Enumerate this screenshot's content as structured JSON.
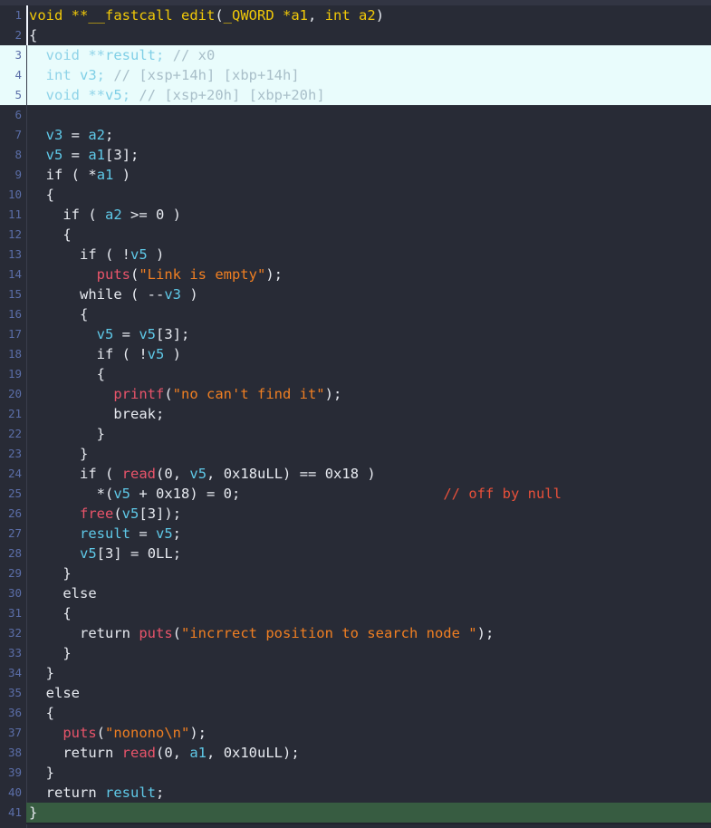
{
  "view": {
    "title": "IDA Pro pseudocode decompiler view",
    "function_name": "edit",
    "theme": {
      "background": "#282b36",
      "gutter_text": "#5b6ea8",
      "plain_text": "#e7eaf0",
      "variable": "#5fc9e8",
      "function_call": "#e8546a",
      "string": "#f07f22",
      "comment": "#e8503a",
      "prototype": "#f0c808",
      "selection_background": "#e9fcfc",
      "current_line_background": "#375c41"
    },
    "total_lines": 41
  },
  "lines": [
    {
      "n": "1",
      "state": "normal",
      "indent": 0,
      "tokens": [
        {
          "t": "void ",
          "c": "proto"
        },
        {
          "t": "**",
          "c": "proto"
        },
        {
          "t": "__fastcall ",
          "c": "proto"
        },
        {
          "t": "edit",
          "c": "proto"
        },
        {
          "t": "(",
          "c": "op"
        },
        {
          "t": "_QWORD ",
          "c": "proto"
        },
        {
          "t": "*",
          "c": "proto"
        },
        {
          "t": "a1",
          "c": "proto"
        },
        {
          "t": ", ",
          "c": "op"
        },
        {
          "t": "int ",
          "c": "proto"
        },
        {
          "t": "a2",
          "c": "proto"
        },
        {
          "t": ")",
          "c": "op"
        }
      ]
    },
    {
      "n": "2",
      "state": "normal",
      "indent": 0,
      "tokens": [
        {
          "t": "{",
          "c": "brc"
        }
      ]
    },
    {
      "n": "3",
      "state": "selected",
      "indent": 1,
      "tokens": [
        {
          "t": "void ",
          "c": "kw"
        },
        {
          "t": "**",
          "c": "op"
        },
        {
          "t": "result",
          "c": "var"
        },
        {
          "t": "; ",
          "c": "op"
        },
        {
          "t": "// x0",
          "c": "cm"
        }
      ]
    },
    {
      "n": "4",
      "state": "selected",
      "indent": 1,
      "tokens": [
        {
          "t": "int ",
          "c": "kw"
        },
        {
          "t": "v3",
          "c": "var"
        },
        {
          "t": "; ",
          "c": "op"
        },
        {
          "t": "// [xsp+14h] [xbp+14h]",
          "c": "cm"
        }
      ]
    },
    {
      "n": "5",
      "state": "selected",
      "indent": 1,
      "tokens": [
        {
          "t": "void ",
          "c": "kw"
        },
        {
          "t": "**",
          "c": "op"
        },
        {
          "t": "v5",
          "c": "var"
        },
        {
          "t": "; ",
          "c": "op"
        },
        {
          "t": "// [xsp+20h] [xbp+20h]",
          "c": "cm"
        }
      ]
    },
    {
      "n": "6",
      "state": "normal",
      "indent": 0,
      "tokens": []
    },
    {
      "n": "7",
      "state": "normal",
      "indent": 1,
      "tokens": [
        {
          "t": "v3",
          "c": "var"
        },
        {
          "t": " = ",
          "c": "op"
        },
        {
          "t": "a2",
          "c": "var"
        },
        {
          "t": ";",
          "c": "op"
        }
      ]
    },
    {
      "n": "8",
      "state": "normal",
      "indent": 1,
      "tokens": [
        {
          "t": "v5",
          "c": "var"
        },
        {
          "t": " = ",
          "c": "op"
        },
        {
          "t": "a1",
          "c": "var"
        },
        {
          "t": "[",
          "c": "op"
        },
        {
          "t": "3",
          "c": "num"
        },
        {
          "t": "];",
          "c": "op"
        }
      ]
    },
    {
      "n": "9",
      "state": "normal",
      "indent": 1,
      "tokens": [
        {
          "t": "if ",
          "c": "kw"
        },
        {
          "t": "( ",
          "c": "op"
        },
        {
          "t": "*",
          "c": "op"
        },
        {
          "t": "a1",
          "c": "var"
        },
        {
          "t": " )",
          "c": "op"
        }
      ]
    },
    {
      "n": "10",
      "state": "normal",
      "indent": 1,
      "tokens": [
        {
          "t": "{",
          "c": "brc"
        }
      ]
    },
    {
      "n": "11",
      "state": "normal",
      "indent": 2,
      "tokens": [
        {
          "t": "if ",
          "c": "kw"
        },
        {
          "t": "( ",
          "c": "op"
        },
        {
          "t": "a2",
          "c": "var"
        },
        {
          "t": " >= ",
          "c": "op"
        },
        {
          "t": "0",
          "c": "num"
        },
        {
          "t": " )",
          "c": "op"
        }
      ]
    },
    {
      "n": "12",
      "state": "normal",
      "indent": 2,
      "tokens": [
        {
          "t": "{",
          "c": "brc"
        }
      ]
    },
    {
      "n": "13",
      "state": "normal",
      "indent": 3,
      "tokens": [
        {
          "t": "if ",
          "c": "kw"
        },
        {
          "t": "( ",
          "c": "op"
        },
        {
          "t": "!",
          "c": "op"
        },
        {
          "t": "v5",
          "c": "var"
        },
        {
          "t": " )",
          "c": "op"
        }
      ]
    },
    {
      "n": "14",
      "state": "normal",
      "indent": 4,
      "tokens": [
        {
          "t": "puts",
          "c": "fn"
        },
        {
          "t": "(",
          "c": "op"
        },
        {
          "t": "\"Link is empty\"",
          "c": "str"
        },
        {
          "t": ");",
          "c": "op"
        }
      ]
    },
    {
      "n": "15",
      "state": "normal",
      "indent": 3,
      "tokens": [
        {
          "t": "while ",
          "c": "kw"
        },
        {
          "t": "( ",
          "c": "op"
        },
        {
          "t": "--",
          "c": "op"
        },
        {
          "t": "v3",
          "c": "var"
        },
        {
          "t": " )",
          "c": "op"
        }
      ]
    },
    {
      "n": "16",
      "state": "normal",
      "indent": 3,
      "tokens": [
        {
          "t": "{",
          "c": "brc"
        }
      ]
    },
    {
      "n": "17",
      "state": "normal",
      "indent": 4,
      "tokens": [
        {
          "t": "v5",
          "c": "var"
        },
        {
          "t": " = ",
          "c": "op"
        },
        {
          "t": "v5",
          "c": "var"
        },
        {
          "t": "[",
          "c": "op"
        },
        {
          "t": "3",
          "c": "num"
        },
        {
          "t": "];",
          "c": "op"
        }
      ]
    },
    {
      "n": "18",
      "state": "normal",
      "indent": 4,
      "tokens": [
        {
          "t": "if ",
          "c": "kw"
        },
        {
          "t": "( ",
          "c": "op"
        },
        {
          "t": "!",
          "c": "op"
        },
        {
          "t": "v5",
          "c": "var"
        },
        {
          "t": " )",
          "c": "op"
        }
      ]
    },
    {
      "n": "19",
      "state": "normal",
      "indent": 4,
      "tokens": [
        {
          "t": "{",
          "c": "brc"
        }
      ]
    },
    {
      "n": "20",
      "state": "normal",
      "indent": 5,
      "tokens": [
        {
          "t": "printf",
          "c": "fn"
        },
        {
          "t": "(",
          "c": "op"
        },
        {
          "t": "\"no can't find it\"",
          "c": "str"
        },
        {
          "t": ");",
          "c": "op"
        }
      ]
    },
    {
      "n": "21",
      "state": "normal",
      "indent": 5,
      "tokens": [
        {
          "t": "break",
          "c": "kw"
        },
        {
          "t": ";",
          "c": "op"
        }
      ]
    },
    {
      "n": "22",
      "state": "normal",
      "indent": 4,
      "tokens": [
        {
          "t": "}",
          "c": "brc"
        }
      ]
    },
    {
      "n": "23",
      "state": "normal",
      "indent": 3,
      "tokens": [
        {
          "t": "}",
          "c": "brc"
        }
      ]
    },
    {
      "n": "24",
      "state": "normal",
      "indent": 3,
      "tokens": [
        {
          "t": "if ",
          "c": "kw"
        },
        {
          "t": "( ",
          "c": "op"
        },
        {
          "t": "read",
          "c": "fn"
        },
        {
          "t": "(",
          "c": "op"
        },
        {
          "t": "0",
          "c": "num"
        },
        {
          "t": ", ",
          "c": "op"
        },
        {
          "t": "v5",
          "c": "var"
        },
        {
          "t": ", ",
          "c": "op"
        },
        {
          "t": "0x18uLL",
          "c": "num"
        },
        {
          "t": ") == ",
          "c": "op"
        },
        {
          "t": "0x18",
          "c": "num"
        },
        {
          "t": " )",
          "c": "op"
        }
      ]
    },
    {
      "n": "25",
      "state": "normal",
      "indent": 4,
      "tokens": [
        {
          "t": "*",
          "c": "op"
        },
        {
          "t": "(",
          "c": "op"
        },
        {
          "t": "v5",
          "c": "var"
        },
        {
          "t": " + ",
          "c": "op"
        },
        {
          "t": "0x18",
          "c": "num"
        },
        {
          "t": ") = ",
          "c": "op"
        },
        {
          "t": "0",
          "c": "num"
        },
        {
          "t": ";",
          "c": "op"
        },
        {
          "t": "                        ",
          "c": "op"
        },
        {
          "t": "// off by null",
          "c": "cm"
        }
      ]
    },
    {
      "n": "26",
      "state": "normal",
      "indent": 3,
      "tokens": [
        {
          "t": "free",
          "c": "fn"
        },
        {
          "t": "(",
          "c": "op"
        },
        {
          "t": "v5",
          "c": "var"
        },
        {
          "t": "[",
          "c": "op"
        },
        {
          "t": "3",
          "c": "num"
        },
        {
          "t": "]);",
          "c": "op"
        }
      ]
    },
    {
      "n": "27",
      "state": "normal",
      "indent": 3,
      "tokens": [
        {
          "t": "result",
          "c": "var"
        },
        {
          "t": " = ",
          "c": "op"
        },
        {
          "t": "v5",
          "c": "var"
        },
        {
          "t": ";",
          "c": "op"
        }
      ]
    },
    {
      "n": "28",
      "state": "normal",
      "indent": 3,
      "tokens": [
        {
          "t": "v5",
          "c": "var"
        },
        {
          "t": "[",
          "c": "op"
        },
        {
          "t": "3",
          "c": "num"
        },
        {
          "t": "] = ",
          "c": "op"
        },
        {
          "t": "0LL",
          "c": "num"
        },
        {
          "t": ";",
          "c": "op"
        }
      ]
    },
    {
      "n": "29",
      "state": "normal",
      "indent": 2,
      "tokens": [
        {
          "t": "}",
          "c": "brc"
        }
      ]
    },
    {
      "n": "30",
      "state": "normal",
      "indent": 2,
      "tokens": [
        {
          "t": "else",
          "c": "kw"
        }
      ]
    },
    {
      "n": "31",
      "state": "normal",
      "indent": 2,
      "tokens": [
        {
          "t": "{",
          "c": "brc"
        }
      ]
    },
    {
      "n": "32",
      "state": "normal",
      "indent": 3,
      "tokens": [
        {
          "t": "return ",
          "c": "kw"
        },
        {
          "t": "puts",
          "c": "fn"
        },
        {
          "t": "(",
          "c": "op"
        },
        {
          "t": "\"incrrect position to search node \"",
          "c": "str"
        },
        {
          "t": ");",
          "c": "op"
        }
      ]
    },
    {
      "n": "33",
      "state": "normal",
      "indent": 2,
      "tokens": [
        {
          "t": "}",
          "c": "brc"
        }
      ]
    },
    {
      "n": "34",
      "state": "normal",
      "indent": 1,
      "tokens": [
        {
          "t": "}",
          "c": "brc"
        }
      ]
    },
    {
      "n": "35",
      "state": "normal",
      "indent": 1,
      "tokens": [
        {
          "t": "else",
          "c": "kw"
        }
      ]
    },
    {
      "n": "36",
      "state": "normal",
      "indent": 1,
      "tokens": [
        {
          "t": "{",
          "c": "brc"
        }
      ]
    },
    {
      "n": "37",
      "state": "normal",
      "indent": 2,
      "tokens": [
        {
          "t": "puts",
          "c": "fn"
        },
        {
          "t": "(",
          "c": "op"
        },
        {
          "t": "\"nonono\\n\"",
          "c": "str"
        },
        {
          "t": ");",
          "c": "op"
        }
      ]
    },
    {
      "n": "38",
      "state": "normal",
      "indent": 2,
      "tokens": [
        {
          "t": "return ",
          "c": "kw"
        },
        {
          "t": "read",
          "c": "fn"
        },
        {
          "t": "(",
          "c": "op"
        },
        {
          "t": "0",
          "c": "num"
        },
        {
          "t": ", ",
          "c": "op"
        },
        {
          "t": "a1",
          "c": "var"
        },
        {
          "t": ", ",
          "c": "op"
        },
        {
          "t": "0x10uLL",
          "c": "num"
        },
        {
          "t": ");",
          "c": "op"
        }
      ]
    },
    {
      "n": "39",
      "state": "normal",
      "indent": 1,
      "tokens": [
        {
          "t": "}",
          "c": "brc"
        }
      ]
    },
    {
      "n": "40",
      "state": "normal",
      "indent": 1,
      "tokens": [
        {
          "t": "return ",
          "c": "kw"
        },
        {
          "t": "result",
          "c": "var"
        },
        {
          "t": ";",
          "c": "op"
        }
      ]
    },
    {
      "n": "41",
      "state": "current",
      "indent": 0,
      "tokens": [
        {
          "t": "}",
          "c": "brc"
        }
      ]
    }
  ]
}
